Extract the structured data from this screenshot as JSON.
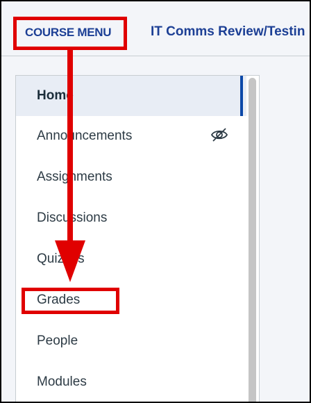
{
  "header": {
    "course_menu_label": "COURSE MENU",
    "course_title": "IT Comms Review/Testin"
  },
  "sidebar": {
    "items": [
      {
        "label": "Home",
        "active": true
      },
      {
        "label": "Announcements",
        "hidden": true,
        "icon": "eye-slash-icon"
      },
      {
        "label": "Assignments"
      },
      {
        "label": "Discussions"
      },
      {
        "label": "Quizzes"
      },
      {
        "label": "Grades",
        "highlighted": true
      },
      {
        "label": "People"
      },
      {
        "label": "Modules"
      }
    ]
  },
  "annotation": {
    "color": "#e00000",
    "description_icon": "arrow-down-icon"
  },
  "colors": {
    "brand_text": "#1c3f95",
    "active_indicator": "#0b48a8",
    "active_background": "#e8edf5"
  }
}
